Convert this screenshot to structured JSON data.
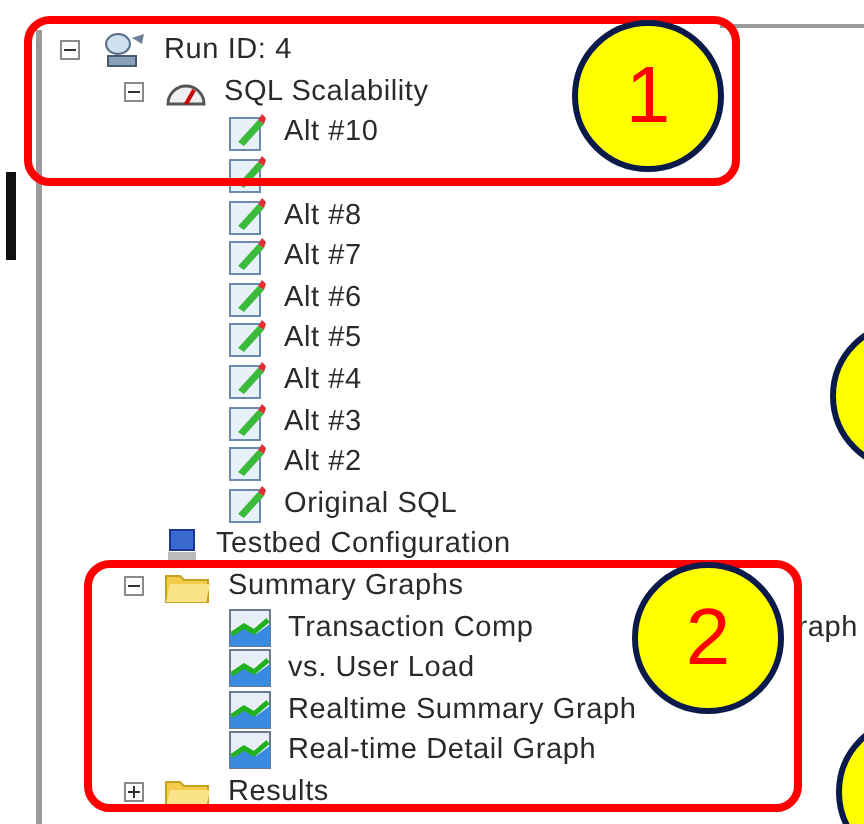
{
  "tree": [
    {
      "label": "Run ID: 4",
      "kind": "run",
      "expanded": true,
      "children": [
        {
          "label": "SQL Scalability",
          "kind": "gauge",
          "expanded": true,
          "children": [
            {
              "label": "Alt #10",
              "kind": "sql"
            },
            {
              "kind": "sql"
            },
            {
              "label": "Alt #8",
              "kind": "sql"
            },
            {
              "label": "Alt #7",
              "kind": "sql"
            },
            {
              "label": "Alt #6",
              "kind": "sql"
            },
            {
              "label": "Alt #5",
              "kind": "sql"
            },
            {
              "label": "Alt #4",
              "kind": "sql"
            },
            {
              "label": "Alt #3",
              "kind": "sql"
            },
            {
              "label": "Alt #2",
              "kind": "sql"
            },
            {
              "label": "Original SQL",
              "kind": "sql"
            }
          ]
        },
        {
          "label": "Testbed Configuration",
          "kind": "config"
        },
        {
          "label": "Summary Graphs",
          "kind": "folder",
          "expanded": true,
          "children": [
            {
              "label": "Transaction Comp",
              "label_end": "raph",
              "kind": "graph"
            },
            {
              "label": "vs. User Load",
              "kind": "graph"
            },
            {
              "label": "Realtime Summary Graph",
              "kind": "graph"
            },
            {
              "label": "Real-time Detail Graph",
              "kind": "graph"
            }
          ]
        },
        {
          "label": "Results",
          "kind": "folder",
          "expanded": false
        }
      ]
    }
  ],
  "annotations": [
    {
      "kind": "callout",
      "number": "1"
    },
    {
      "kind": "callout",
      "number": "2"
    },
    {
      "kind": "edge-circle"
    },
    {
      "kind": "edge-circle"
    }
  ]
}
